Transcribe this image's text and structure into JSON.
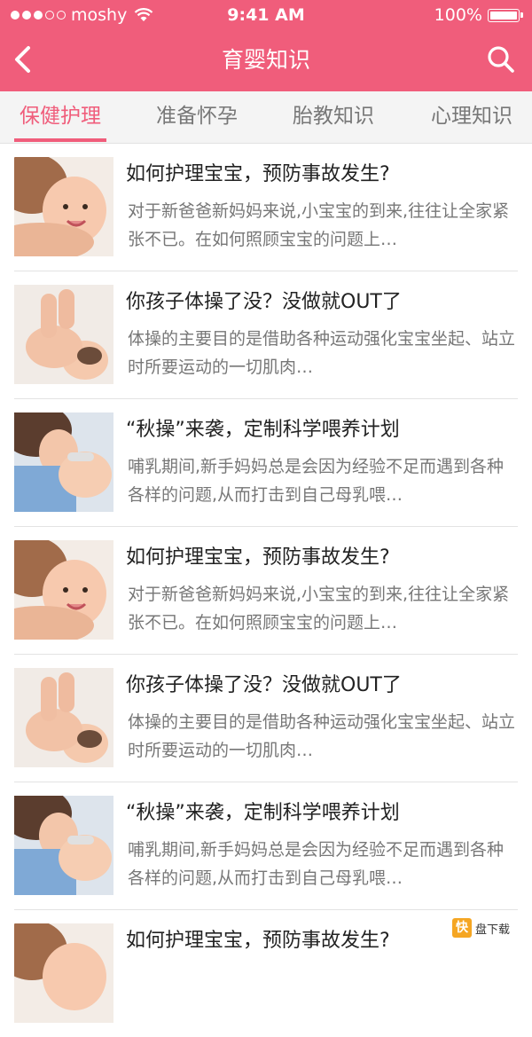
{
  "status_bar": {
    "carrier": "moshy",
    "time": "9:41 AM",
    "battery": "100%"
  },
  "header": {
    "title": "育婴知识"
  },
  "tabs": [
    {
      "label": "保健护理",
      "active": true
    },
    {
      "label": "准备怀孕",
      "active": false
    },
    {
      "label": "胎教知识",
      "active": false
    },
    {
      "label": "心理知识",
      "active": false
    }
  ],
  "articles": [
    {
      "title": "如何护理宝宝，预防事故发生?",
      "desc": "对于新爸爸新妈妈来说,小宝宝的到来,往往让全家紧张不已。在如何照顾宝宝的问题上…",
      "image": "mother-baby-photo"
    },
    {
      "title": "你孩子体操了没？没做就OUT了",
      "desc": "体操的主要目的是借助各种运动强化宝宝坐起、站立时所要运动的一切肌肉…",
      "image": "baby-exercise-photo"
    },
    {
      "title": "“秋操”来袭，定制科学喂养计划",
      "desc": "哺乳期间,新手妈妈总是会因为经验不足而遇到各种各样的问题,从而打击到自己母乳喂…",
      "image": "feeding-photo"
    },
    {
      "title": "如何护理宝宝，预防事故发生?",
      "desc": "对于新爸爸新妈妈来说,小宝宝的到来,往往让全家紧张不已。在如何照顾宝宝的问题上…",
      "image": "mother-baby-photo"
    },
    {
      "title": "你孩子体操了没？没做就OUT了",
      "desc": "体操的主要目的是借助各种运动强化宝宝坐起、站立时所要运动的一切肌肉…",
      "image": "baby-exercise-photo"
    },
    {
      "title": "“秋操”来袭，定制科学喂养计划",
      "desc": "哺乳期间,新手妈妈总是会因为经验不足而遇到各种各样的问题,从而打击到自己母乳喂…",
      "image": "feeding-photo"
    },
    {
      "title": "如何护理宝宝，预防事故发生?",
      "desc": "",
      "image": "mother-baby-photo"
    }
  ],
  "watermark": {
    "icon_text": "快",
    "label": "盘下载"
  },
  "colors": {
    "brand": "#f05d7b"
  }
}
